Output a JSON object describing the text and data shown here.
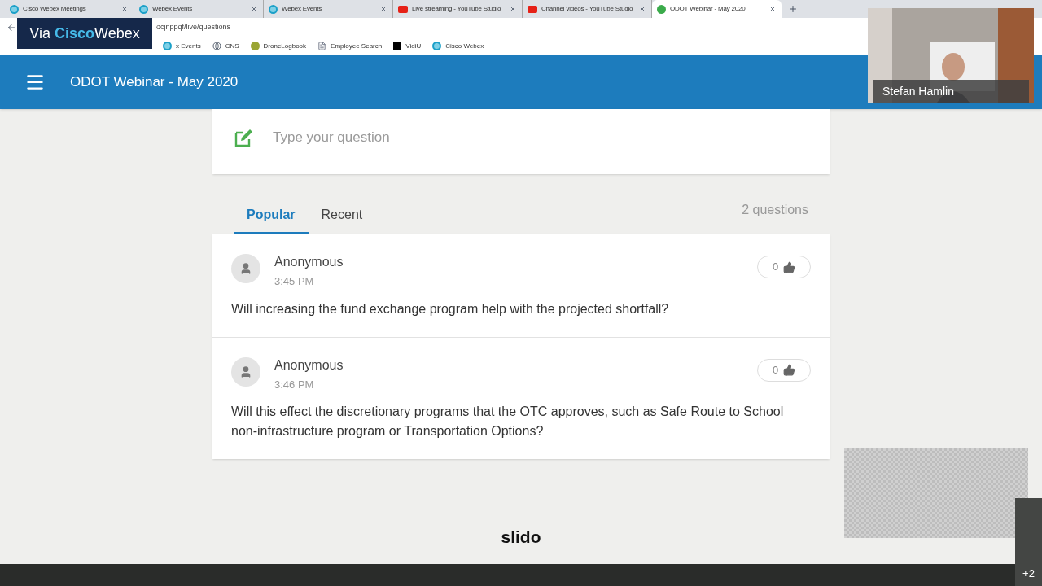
{
  "browser": {
    "tabs": [
      {
        "title": "Cisco Webex Meetings",
        "kind": "webex",
        "selected": false
      },
      {
        "title": "Webex Events",
        "kind": "webex",
        "selected": false
      },
      {
        "title": "Webex Events",
        "kind": "webex",
        "selected": false
      },
      {
        "title": "Live streaming - YouTube Studio",
        "kind": "youtube",
        "selected": false
      },
      {
        "title": "Channel videos - YouTube Studio",
        "kind": "youtube",
        "selected": false
      },
      {
        "title": "ODOT Webinar - May 2020",
        "kind": "slido",
        "selected": true
      }
    ],
    "address": "ocjnppqf/live/questions",
    "bookmarks": [
      {
        "label": "x Events",
        "kind": "webex"
      },
      {
        "label": "CNS",
        "kind": "globe"
      },
      {
        "label": "DroneLogbook",
        "kind": "drone"
      },
      {
        "label": "Employee Search",
        "kind": "page"
      },
      {
        "label": "VidiU",
        "kind": "vidiu"
      },
      {
        "label": "Cisco Webex",
        "kind": "webex"
      }
    ]
  },
  "overlay_badge": {
    "prefix": "Via",
    "brand": "Cisco",
    "product": "Webex"
  },
  "header": {
    "title": "ODOT Webinar - May 2020"
  },
  "question_input": {
    "placeholder": "Type your question"
  },
  "tabs": [
    {
      "label": "Popular",
      "selected": true
    },
    {
      "label": "Recent",
      "selected": false
    }
  ],
  "question_count": "2 questions",
  "questions": [
    {
      "author": "Anonymous",
      "time": "3:45 PM",
      "likes": "0",
      "text": "Will increasing the fund exchange program help with the projected shortfall?"
    },
    {
      "author": "Anonymous",
      "time": "3:46 PM",
      "likes": "0",
      "text": "Will this effect the discretionary programs that the OTC approves, such as Safe Route to School non-infrastructure program or Transportation Options?"
    }
  ],
  "footer_logo": "slido",
  "video": {
    "name": "Stefan Hamlin"
  },
  "participants_more": "+2"
}
